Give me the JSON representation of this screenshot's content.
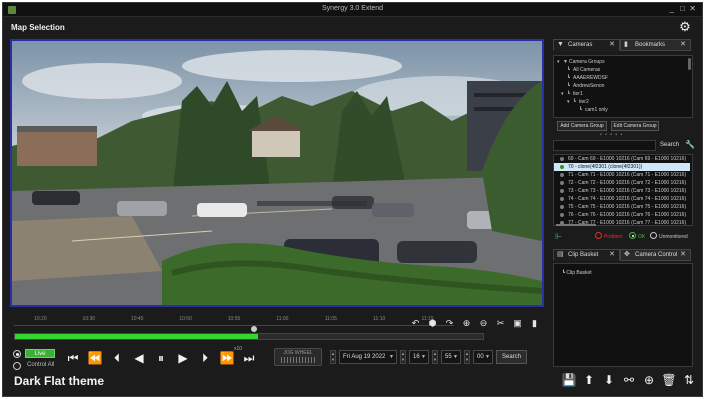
{
  "window": {
    "title": "Synergy 3.0 Extend",
    "page_title": "Map Selection",
    "controls": {
      "minimize": "_",
      "maximize": "□",
      "close": "✕"
    }
  },
  "timeline": {
    "ticks": [
      "10:20",
      "10:30",
      "10:40",
      "10:50",
      "10:55",
      "11:00",
      "11:05",
      "11:10",
      "11:15"
    ],
    "played_fraction": 0.52,
    "thumb_fraction": 0.51,
    "tools": [
      "undo-icon",
      "bookmark-add-icon",
      "redo-icon",
      "zoom-in-icon",
      "zoom-out-icon",
      "cut-icon",
      "export-icon",
      "bookmark-icon"
    ]
  },
  "playback": {
    "live_label": "Live",
    "control_all_label": "Control All",
    "speed_label": "x10",
    "jog_label": "JOG WHEEL",
    "date": "Fri Aug 19 2022",
    "hour": "16",
    "minute": "55",
    "second": "00",
    "search_label": "Search",
    "colors": {
      "accent_green": "#3cb034",
      "timeline_green": "#35d62f"
    }
  },
  "theme_label": "Dark Flat theme",
  "right_panel": {
    "tabs_top": [
      {
        "label": "Cameras",
        "icon": "camera-group-icon"
      },
      {
        "label": "Bookmarks",
        "icon": "bookmark-icon"
      }
    ],
    "tree": [
      {
        "label": "Camera Groups",
        "icon": "folder-icon",
        "expand": "▾"
      },
      {
        "label": "All Cameras",
        "icon": "list-icon",
        "expand": ""
      },
      {
        "label": "AAAEREWDSF",
        "icon": "list-icon",
        "expand": ""
      },
      {
        "label": "AndrewSenon",
        "icon": "list-icon",
        "expand": ""
      },
      {
        "label": "tier1",
        "icon": "list-icon",
        "expand": "▾"
      },
      {
        "label": "tier2",
        "icon": "list-icon",
        "expand": "▾"
      },
      {
        "label": "cam1 only",
        "icon": "list-icon",
        "expand": ""
      }
    ],
    "add_group_label": "Add Camera Group",
    "edit_group_label": "Edit Camera Group",
    "search_label": "Search",
    "cameras": [
      {
        "label": "69 - Cam 69 - E1000 10216 (Cam 69 - E1000 10216)",
        "selected": false
      },
      {
        "label": "70 - clone(4f2301 (clone(4f2301))",
        "selected": true
      },
      {
        "label": "71 - Cam 71 - E1000 10216 (Cam 71 - E1000 10216)",
        "selected": false
      },
      {
        "label": "72 - Cam 72 - E1000 10216 (Cam 72 - E1000 10216)",
        "selected": false
      },
      {
        "label": "73 - Cam 73 - E1000 10216 (Cam 73 - E1000 10216)",
        "selected": false
      },
      {
        "label": "74 - Cam 74 - E1000 10216 (Cam 74 - E1000 10216)",
        "selected": false
      },
      {
        "label": "75 - Cam 75 - E1000 10216 (Cam 75 - E1000 10216)",
        "selected": false
      },
      {
        "label": "76 - Cam 76 - E1000 10216 (Cam 76 - E1000 10216)",
        "selected": false
      },
      {
        "label": "77 - Cam 77 - E1000 10216 (Cam 77 - E1000 10216)",
        "selected": false
      }
    ],
    "status_filters": [
      {
        "label": "Problem",
        "color": "#e0302a",
        "on": false
      },
      {
        "label": "OK",
        "color": "#3fbf3a",
        "on": true
      },
      {
        "label": "Unmonitored",
        "color": "#c8c8c8",
        "on": false
      }
    ],
    "tabs_bottom": [
      {
        "label": "Clip Basket",
        "icon": "basket-icon"
      },
      {
        "label": "Camera Control",
        "icon": "ptz-icon"
      }
    ],
    "clip_tree_item": "Clip Basket",
    "bottom_tools": [
      "save-icon",
      "arrow-up-icon",
      "arrow-down-icon",
      "unlink-icon",
      "add-icon",
      "delete-icon",
      "sort-icon"
    ]
  }
}
